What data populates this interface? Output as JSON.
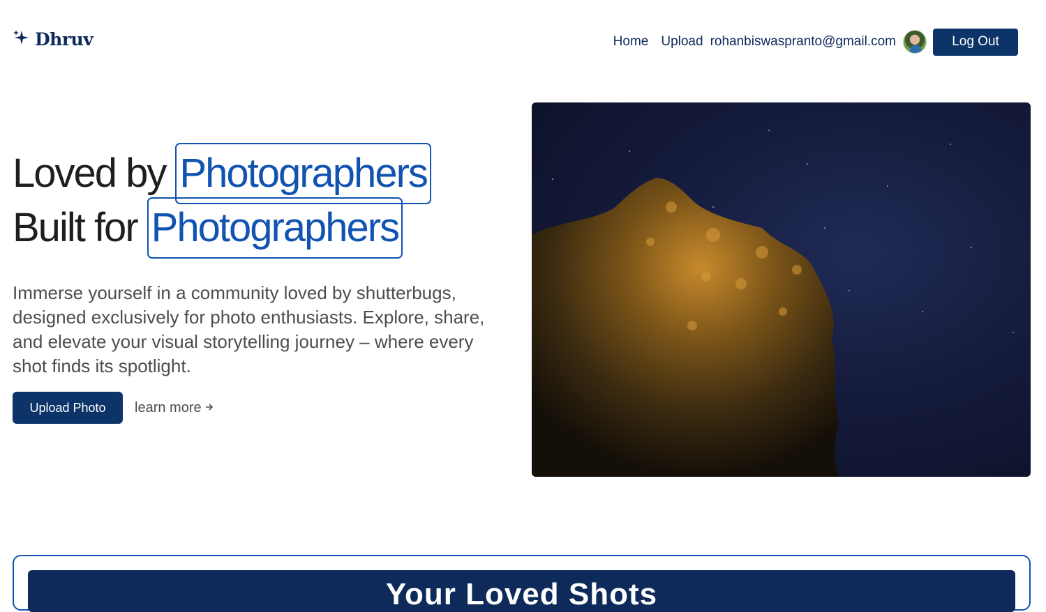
{
  "brand": {
    "name": "Dhruv",
    "icon": "sparkle-icon",
    "color": "#0d2a5a"
  },
  "nav": {
    "home": "Home",
    "upload": "Upload",
    "email": "rohanbiswaspranto@gmail.com",
    "avatar": "avatar",
    "logout": "Log Out"
  },
  "hero": {
    "line1_prefix": "Loved by",
    "line1_highlight": "Photographers",
    "line2_prefix": "Built for",
    "line2_highlight": "Photographers",
    "description": "Immerse yourself in a community loved by shutterbugs, designed exclusively for photo enthusiasts. Explore, share, and elevate your visual storytelling journey – where every shot finds its spotlight.",
    "upload_button": "Upload Photo",
    "learn_more": "learn more",
    "learn_more_icon": "arrow-right-icon"
  },
  "section": {
    "title": "Your Loved Shots"
  },
  "colors": {
    "primary": "#0d3468",
    "highlight": "#1053b0",
    "text": "#1e1e1e",
    "muted": "#4d4d4d"
  }
}
